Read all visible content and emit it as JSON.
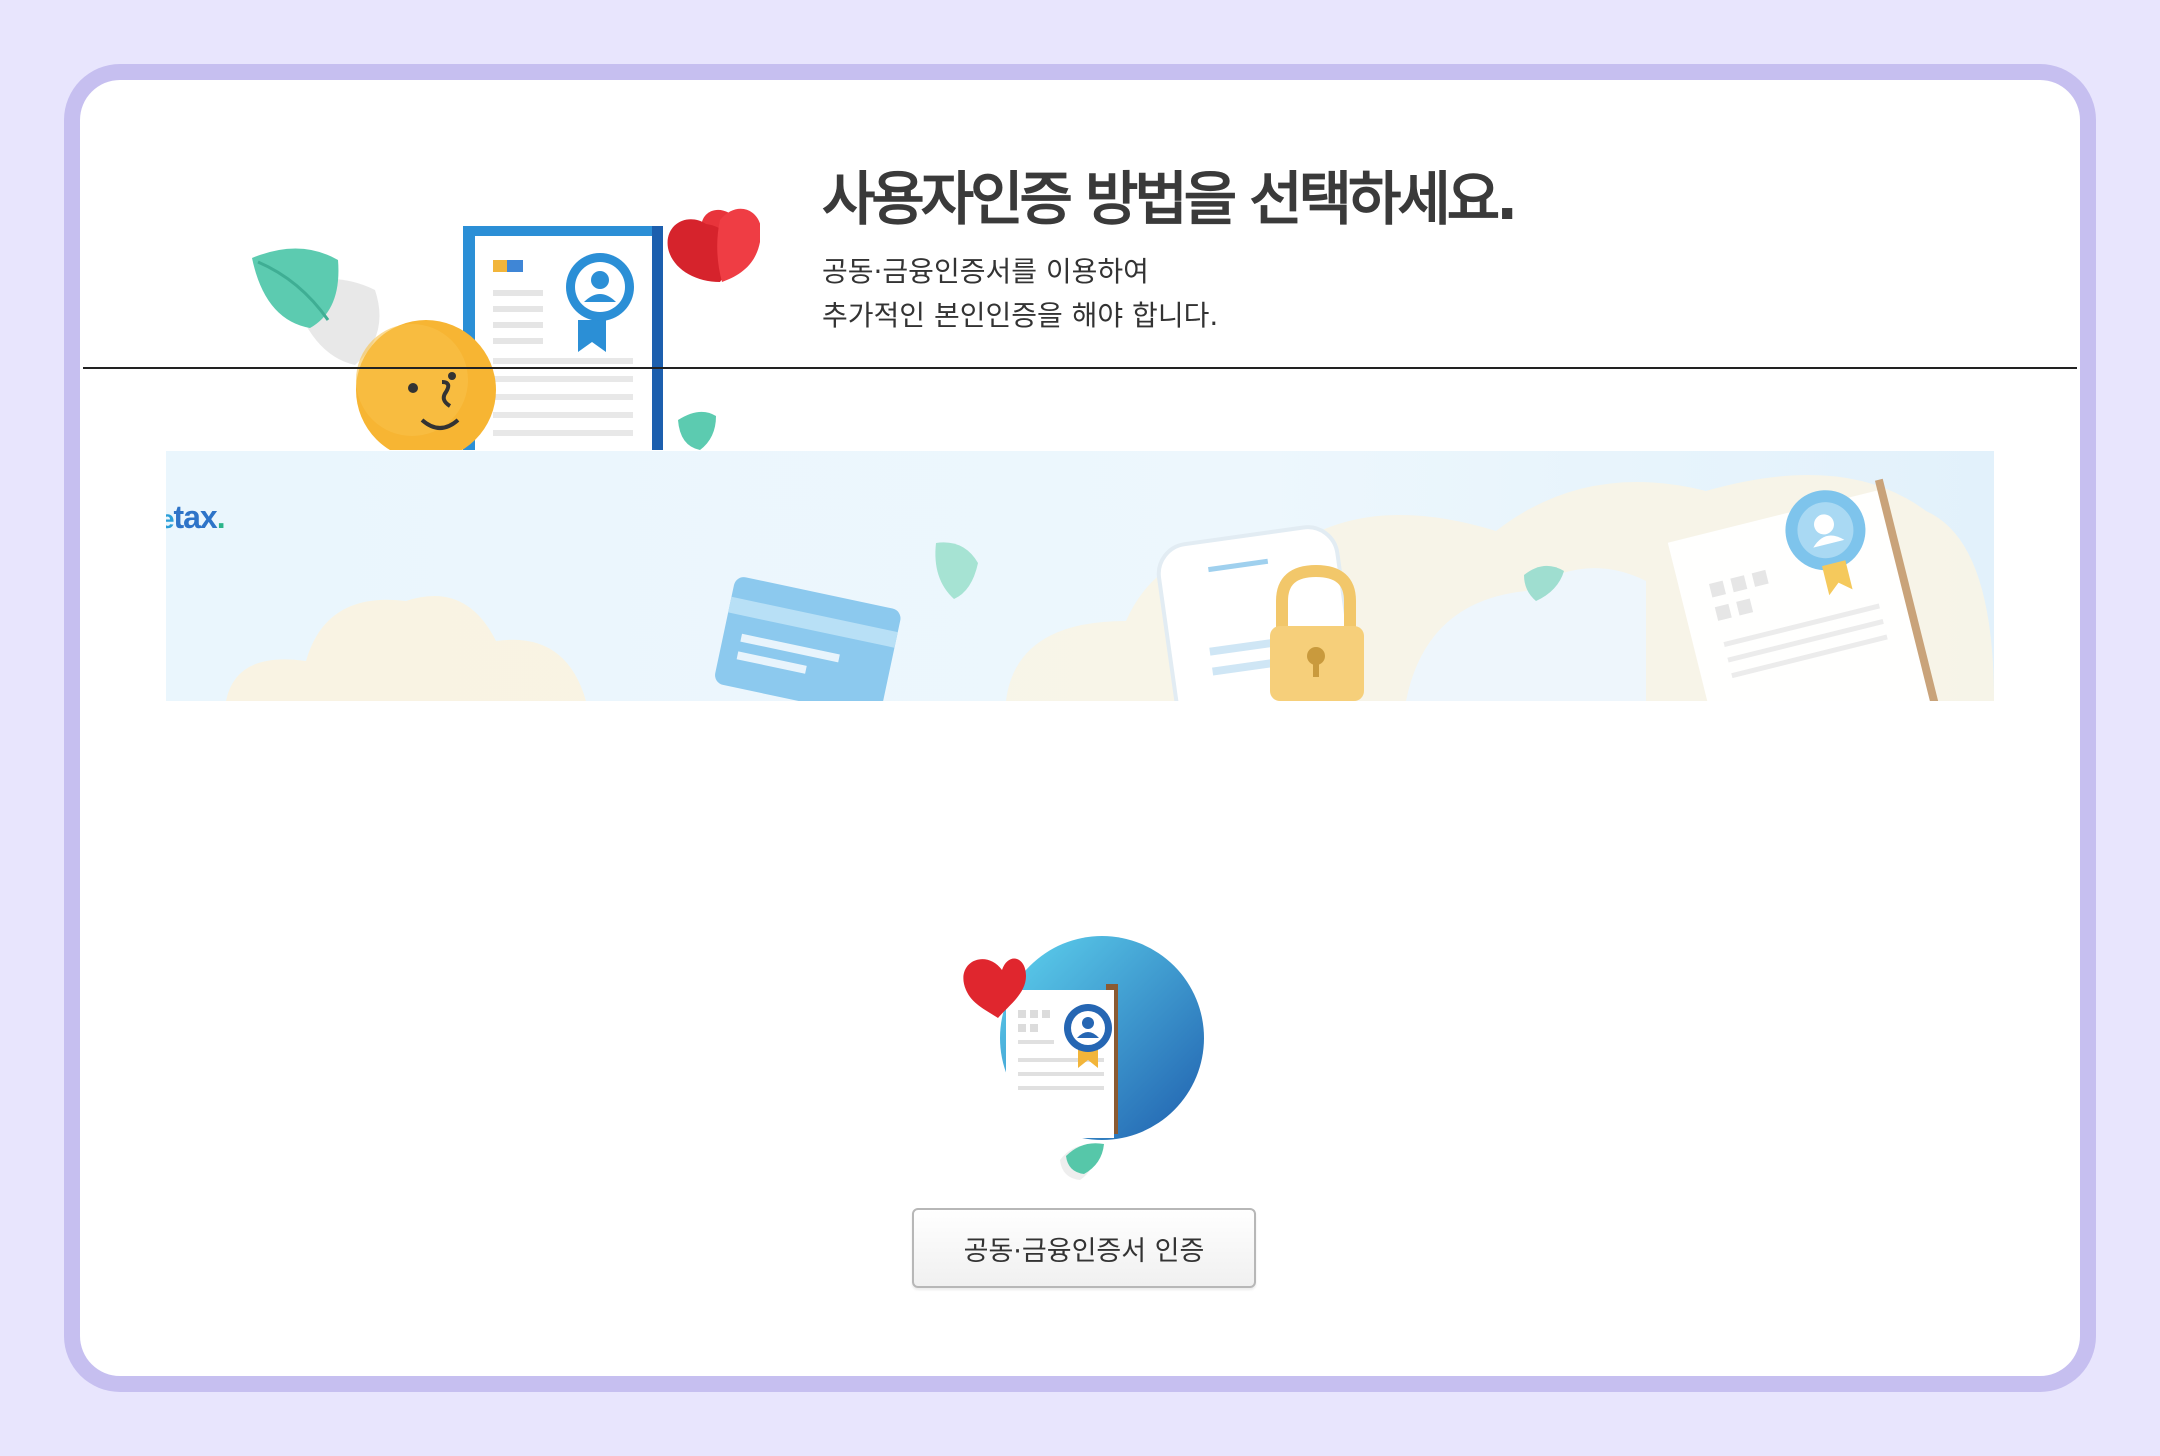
{
  "header": {
    "title": "사용자인증 방법을 선택하세요.",
    "description_lines": [
      "공동·금융인증서를 이용하여",
      "추가적인 본인인증을 해야 합니다."
    ]
  },
  "banner": {
    "logo_prefix": "e",
    "logo_text": "tax",
    "logo_suffix": "."
  },
  "auth_options": [
    {
      "button_label": "공동·금융인증서 인증",
      "icon": "certificate-icon"
    }
  ],
  "colors": {
    "page_background": "#e8e5fd",
    "frame_border": "#c6bff0",
    "panel_background": "#ffffff",
    "title_text": "#3a3a3a",
    "accent_blue": "#2e74c8",
    "heart_red": "#e8343b",
    "leaf_green": "#4fc8a8",
    "character_yellow": "#f7b533"
  }
}
